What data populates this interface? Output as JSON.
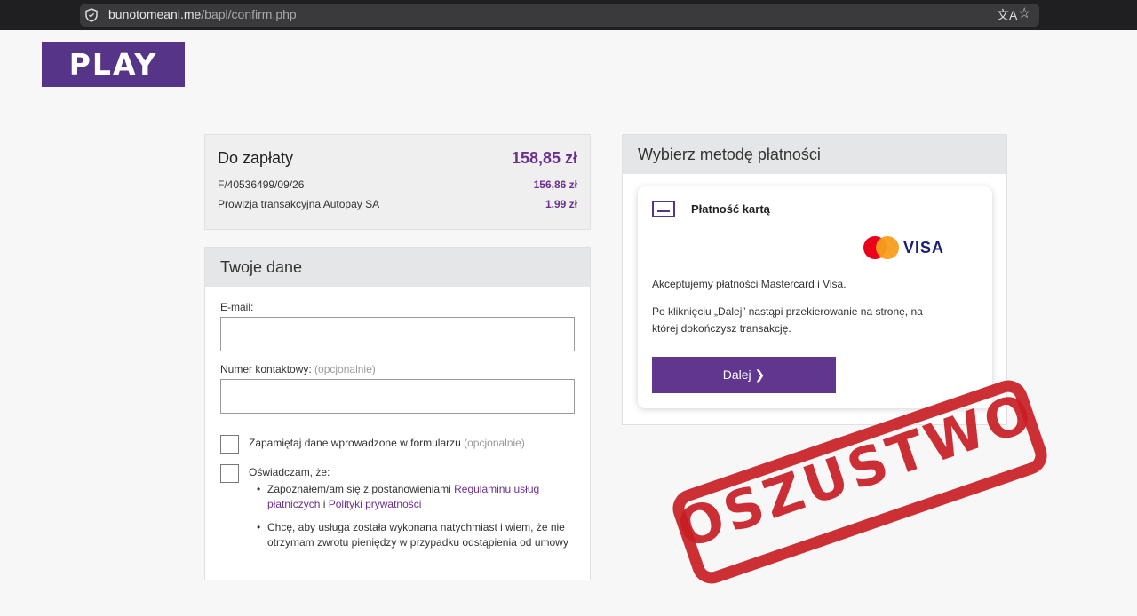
{
  "browser": {
    "url_host": "bunotomeani.me",
    "url_path": "/bapl/confirm.php"
  },
  "logo": {
    "text": "PLAY"
  },
  "summary": {
    "title": "Do zapłaty",
    "total": "158,85 zł",
    "rows": [
      {
        "label": "F/40536499/09/26",
        "value": "156,86 zł"
      },
      {
        "label": "Prowizja transakcyjna Autopay SA",
        "value": "1,99 zł"
      }
    ]
  },
  "form": {
    "title": "Twoje dane",
    "email_label": "E-mail:",
    "phone_label": "Numer kontaktowy:",
    "phone_optional": "(opcjonalnie)",
    "remember_label": "Zapamiętaj dane wprowadzone w formularzu",
    "remember_optional": "(opcjonalnie)",
    "declare_label": "Oświadczam, że:",
    "bullet1_prefix": "Zapoznałem/am się z postanowieniami",
    "bullet1_link1": "Regulaminu usług płatniczych",
    "bullet1_join": "i",
    "bullet1_link2": "Polityki prywatności",
    "bullet2": "Chcę, aby usługa została wykonana natychmiast i wiem, że nie otrzymam zwrotu pieniędzy w przypadku odstąpienia od umowy"
  },
  "payment": {
    "title": "Wybierz metodę płatności",
    "card_title": "Płatność kartą",
    "visa": "VISA",
    "accept_text": "Akceptujemy płatności Mastercard i Visa.",
    "redirect_text": "Po kliknięciu „Dalej” nastąpi przekierowanie na stronę, na której dokończysz transakcję.",
    "button_label": "Dalej ❯"
  },
  "stamp": {
    "text": "OSZUSTWO"
  },
  "colors": {
    "brand": "#563589",
    "accent": "#6b2f8f",
    "stamp": "#c81e24"
  }
}
